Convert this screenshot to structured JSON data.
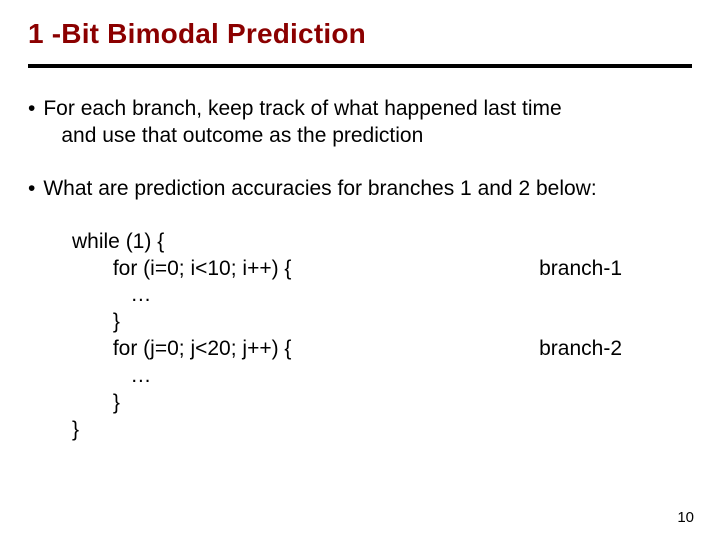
{
  "title": "1 -Bit Bimodal Prediction",
  "bullets": [
    {
      "line1": "For each branch, keep track of what happened last time",
      "line2": "and use that outcome as the prediction"
    },
    {
      "line1": "What are prediction accuracies for branches 1 and 2 below:"
    }
  ],
  "code": {
    "l0": "while (1) {",
    "l1": "       for (i=0; i<10; i++) {",
    "r1": "branch-1",
    "l2": "          …",
    "l3": "       }",
    "l4": "       for (j=0; j<20; j++) {",
    "r4": "branch-2",
    "l5": "          …",
    "l6": "       }",
    "l7": "}"
  },
  "page_number": "10"
}
